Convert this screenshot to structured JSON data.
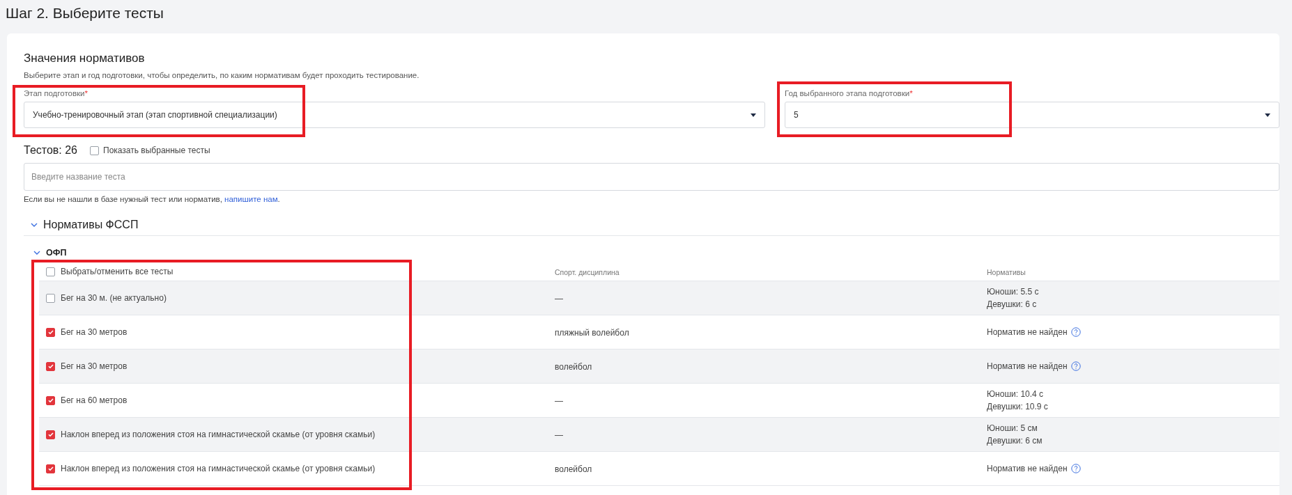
{
  "page_title": "Шаг 2. Выберите тесты",
  "section": {
    "title": "Значения нормативов",
    "description": "Выберите этап и год подготовки, чтобы определить, по каким нормативам будет проходить тестирование."
  },
  "selects": [
    {
      "label": "Этап подготовки",
      "required_mark": "*",
      "value": "Учебно-тренировочный этап (этап спортивной специализации)"
    },
    {
      "label": "Год выбранного этапа подготовки",
      "required_mark": "*",
      "value": "5"
    }
  ],
  "tests": {
    "count_label": "Тестов: 26",
    "show_selected": {
      "label": "Показать выбранные тесты",
      "checked": false
    },
    "search": {
      "placeholder": "Введите название теста"
    },
    "note": {
      "text": "Если вы не нашли в базе нужный тест или норматив, ",
      "link": "напишите нам",
      "tail": "."
    }
  },
  "groups": [
    {
      "title": "Нормативы ФССП",
      "expanded": true,
      "children": [
        {
          "title": "ОФП",
          "expanded": true,
          "table": {
            "select_all": {
              "label": "Выбрать/отменить все тесты",
              "checked": false
            },
            "columns": [
              "Спорт. дисциплина",
              "Нормативы"
            ],
            "rows": [
              {
                "name": "Бег на 30 м. (не актуально)",
                "checked": false,
                "discipline": "—",
                "norm": {
                  "kind": "values",
                  "lines": [
                    "Юноши: 5.5 с",
                    "Девушки: 6 с"
                  ]
                }
              },
              {
                "name": "Бег на 30 метров",
                "checked": true,
                "discipline": "пляжный волейбол",
                "norm": {
                  "kind": "not_found",
                  "text": "Норматив не найден"
                }
              },
              {
                "name": "Бег на 30 метров",
                "checked": true,
                "discipline": "волейбол",
                "norm": {
                  "kind": "not_found",
                  "text": "Норматив не найден"
                }
              },
              {
                "name": "Бег на 60 метров",
                "checked": true,
                "discipline": "—",
                "norm": {
                  "kind": "values",
                  "lines": [
                    "Юноши: 10.4 с",
                    "Девушки: 10.9 с"
                  ]
                }
              },
              {
                "name": "Наклон вперед из положения стоя на гимнастической скамье (от уровня скамьи)",
                "checked": true,
                "discipline": "—",
                "norm": {
                  "kind": "values",
                  "lines": [
                    "Юноши: 5 см",
                    "Девушки: 6 см"
                  ]
                }
              },
              {
                "name": "Наклон вперед из положения стоя на гимнастической скамье (от уровня скамьи)",
                "checked": true,
                "discipline": "волейбол",
                "norm": {
                  "kind": "not_found",
                  "text": "Норматив не найден"
                }
              }
            ]
          }
        }
      ]
    }
  ]
}
